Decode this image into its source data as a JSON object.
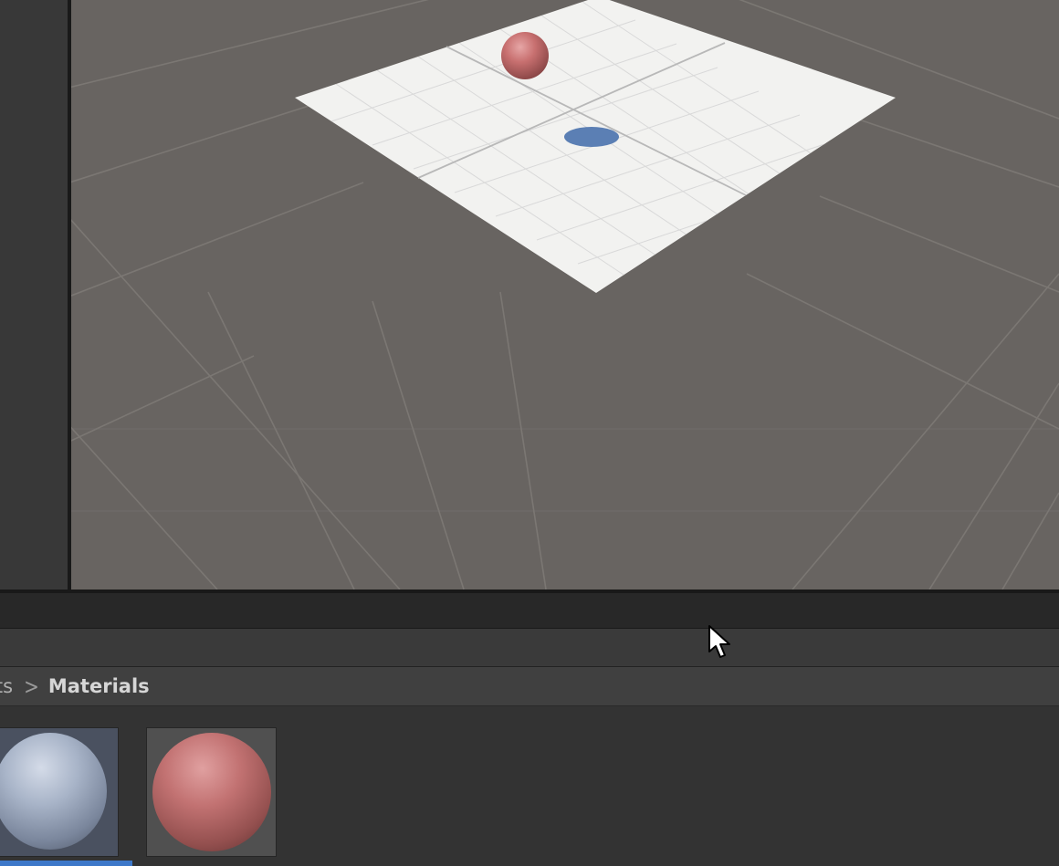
{
  "project": {
    "breadcrumb": {
      "partial_first": "ets",
      "separator": ">",
      "current": "Materials"
    },
    "assets": [
      {
        "id": "blue-material",
        "color": "#a8b4c8",
        "selected": true
      },
      {
        "id": "red-material",
        "color": "#c27272",
        "selected": false
      }
    ]
  },
  "scene": {
    "background_color": "#686461",
    "plane_color": "#f2f2f0",
    "sphere_color": "#c87070",
    "shadow_color": "#5b7fb4"
  },
  "colors": {
    "selection_accent": "#3d78c9"
  }
}
